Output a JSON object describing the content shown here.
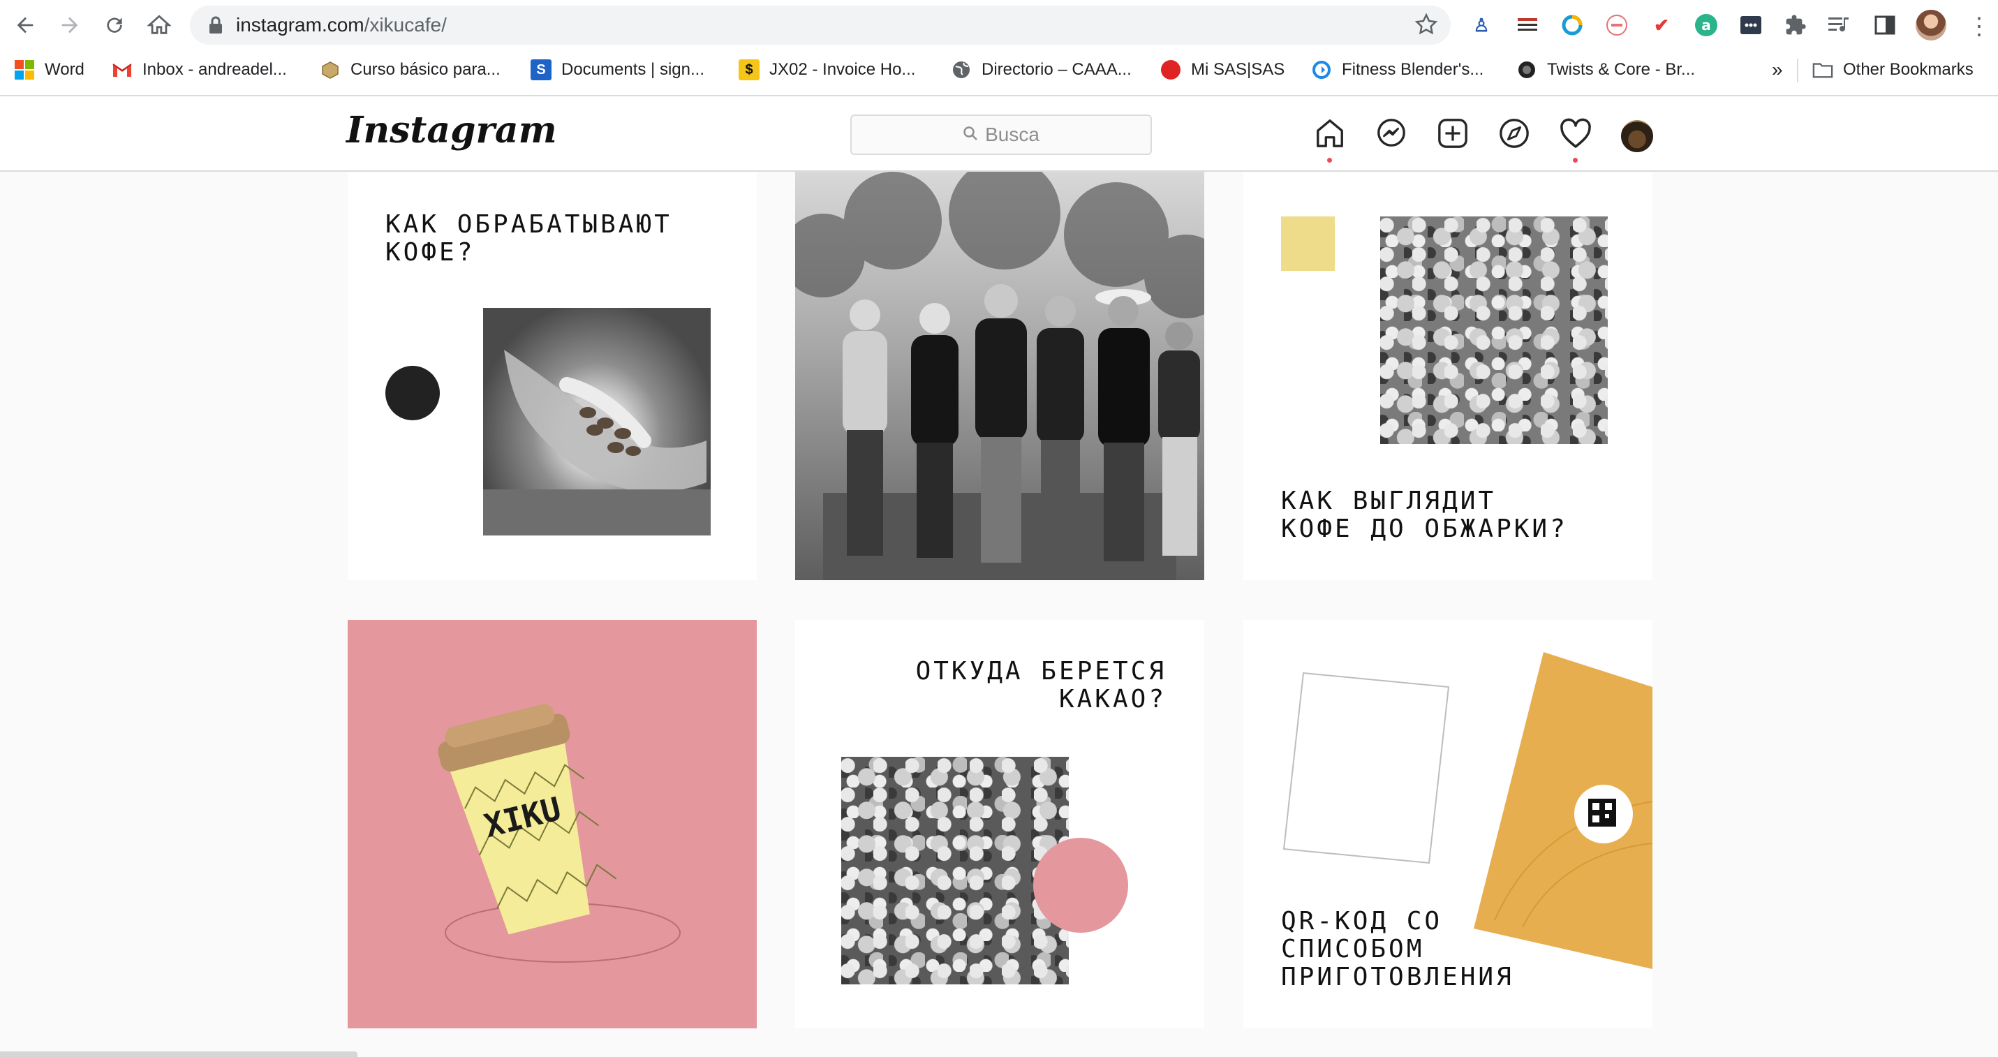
{
  "browser": {
    "url_host": "instagram.com",
    "url_path": "/xikucafe/",
    "bookmarks": [
      {
        "label": "Word",
        "icon": "microsoft-icon"
      },
      {
        "label": "Inbox - andreadel...",
        "icon": "gmail-icon"
      },
      {
        "label": "Curso básico para...",
        "icon": "box-icon"
      },
      {
        "label": "Documents | sign...",
        "icon": "docs-icon"
      },
      {
        "label": "JX02 - Invoice Ho...",
        "icon": "dollar-icon"
      },
      {
        "label": "Directorio – CAAA...",
        "icon": "globe-icon"
      },
      {
        "label": "Mi SAS|SAS",
        "icon": "red-dot-icon"
      },
      {
        "label": "Fitness Blender's...",
        "icon": "refresh-icon"
      },
      {
        "label": "Twists & Core - Br...",
        "icon": "globe-dark-icon"
      }
    ],
    "overflow_label": "»",
    "other_bookmarks": "Other Bookmarks"
  },
  "instagram": {
    "logo": "Instagram",
    "search_placeholder": "Busca"
  },
  "posts": {
    "p1_title": "КАК ОБРАБАТЫВАЮТ\nКОФЕ?",
    "p3_title": "КАК ВЫГЛЯДИТ\nКОФЕ ДО ОБЖАРКИ?",
    "p4_cup_brand": "XIKU",
    "p5_title": "ОТКУДА БЕРЕТСЯ\nКАКАО?",
    "p6_title": "QR-КОД СО\nСПИСОБОМ\nПРИГОТОВЛЕНИЯ"
  },
  "colors": {
    "pink": "#e4989d",
    "yellow_swatch": "#eedc8a",
    "pouch": "#e6ae4e",
    "cup": "#f4ec98",
    "lid": "#b79064"
  }
}
